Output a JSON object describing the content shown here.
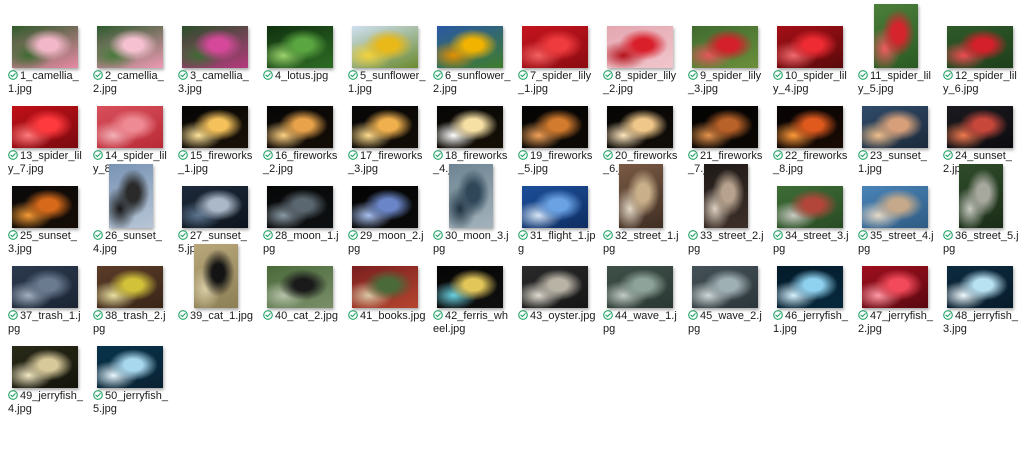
{
  "colors": {
    "sync_check": "#21a366",
    "background": "#ffffff",
    "caption_text": "#1a1a1a"
  },
  "status_icon": "cloud-synced-check-icon",
  "files": [
    {
      "name": "1_camellia_1.jpg",
      "orientation": "landscape",
      "thumb": [
        "#2f5a2a",
        "#f2b7c8",
        "#e88aa6",
        "#3d6b31"
      ]
    },
    {
      "name": "2_camellia_2.jpg",
      "orientation": "landscape",
      "thumb": [
        "#2c5a2c",
        "#f6c2d2",
        "#ef9ab5",
        "#477a3a"
      ]
    },
    {
      "name": "3_camellia_3.jpg",
      "orientation": "landscape",
      "thumb": [
        "#2b4f2a",
        "#d6499a",
        "#b53a7d",
        "#3f6b35"
      ]
    },
    {
      "name": "4_lotus.jpg",
      "orientation": "landscape",
      "thumb": [
        "#10310f",
        "#5aa640",
        "#2e6c25",
        "#9bd36c"
      ]
    },
    {
      "name": "5_sunflower_1.jpg",
      "orientation": "landscape",
      "thumb": [
        "#cfe0f0",
        "#e9b919",
        "#6a8a2f",
        "#f5d33a"
      ]
    },
    {
      "name": "6_sunflower_2.jpg",
      "orientation": "landscape",
      "thumb": [
        "#2a58a5",
        "#f2b300",
        "#3f7d2b",
        "#e28f00"
      ]
    },
    {
      "name": "7_spider_lily_1.jpg",
      "orientation": "landscape",
      "thumb": [
        "#c5141e",
        "#ee3b3e",
        "#8b0b12",
        "#f46262"
      ]
    },
    {
      "name": "8_spider_lily_2.jpg",
      "orientation": "landscape",
      "thumb": [
        "#e4a6b0",
        "#d81f2a",
        "#f0c6cc",
        "#b5121b"
      ]
    },
    {
      "name": "9_spider_lily_3.jpg",
      "orientation": "landscape",
      "thumb": [
        "#3f6b30",
        "#d4202a",
        "#6b8f3a",
        "#e4565a"
      ]
    },
    {
      "name": "10_spider_lily_4.jpg",
      "orientation": "landscape",
      "thumb": [
        "#a40f16",
        "#ee2b33",
        "#5a0a0c",
        "#f06a6d"
      ]
    },
    {
      "name": "11_spider_lily_5.jpg",
      "orientation": "portrait",
      "thumb": [
        "#4b7f3a",
        "#d6242d",
        "#2a5a23",
        "#f05a5f"
      ]
    },
    {
      "name": "12_spider_lily_6.jpg",
      "orientation": "landscape",
      "thumb": [
        "#2f5a2a",
        "#d4202a",
        "#1e3f1b",
        "#ee4c52"
      ]
    },
    {
      "name": "13_spider_lily_7.jpg",
      "orientation": "landscape",
      "thumb": [
        "#c11018",
        "#ff3a3e",
        "#7a0a0f",
        "#ff7a7c"
      ]
    },
    {
      "name": "14_spider_lily_8.jpg",
      "orientation": "landscape",
      "thumb": [
        "#d8505c",
        "#ee8a93",
        "#b82a36",
        "#f4b2b8"
      ]
    },
    {
      "name": "15_fireworks_1.jpg",
      "orientation": "landscape",
      "thumb": [
        "#050505",
        "#f4c15a",
        "#1a1208",
        "#ffe39a"
      ]
    },
    {
      "name": "16_fireworks_2.jpg",
      "orientation": "landscape",
      "thumb": [
        "#060606",
        "#e8a34a",
        "#140d06",
        "#ffd283"
      ]
    },
    {
      "name": "17_fireworks_3.jpg",
      "orientation": "landscape",
      "thumb": [
        "#070707",
        "#f0b04d",
        "#120c05",
        "#ffdc8e"
      ]
    },
    {
      "name": "18_fireworks_4.jpg",
      "orientation": "landscape",
      "thumb": [
        "#060606",
        "#f7e0a4",
        "#151006",
        "#ffffff"
      ]
    },
    {
      "name": "19_fireworks_5.jpg",
      "orientation": "landscape",
      "thumb": [
        "#040404",
        "#d27a2d",
        "#0d0905",
        "#f2a35a"
      ]
    },
    {
      "name": "20_fireworks_6.jpg",
      "orientation": "landscape",
      "thumb": [
        "#050505",
        "#f0c78a",
        "#120d07",
        "#ffe7bf"
      ]
    },
    {
      "name": "21_fireworks_7.jpg",
      "orientation": "landscape",
      "thumb": [
        "#030303",
        "#b86128",
        "#0b0704",
        "#e5934c"
      ]
    },
    {
      "name": "22_fireworks_8.jpg",
      "orientation": "landscape",
      "thumb": [
        "#050303",
        "#e05a1e",
        "#1a0b05",
        "#ff9a3a"
      ]
    },
    {
      "name": "23_sunset_1.jpg",
      "orientation": "landscape",
      "thumb": [
        "#2f4b6a",
        "#d8a07a",
        "#1c2a3b",
        "#f1c08c"
      ]
    },
    {
      "name": "24_sunset_2.jpg",
      "orientation": "landscape",
      "thumb": [
        "#1a1a1f",
        "#c7473b",
        "#0c0c10",
        "#f07a4f"
      ]
    },
    {
      "name": "25_sunset_3.jpg",
      "orientation": "landscape",
      "thumb": [
        "#0a0a0a",
        "#d66a1a",
        "#160c05",
        "#f49a35"
      ]
    },
    {
      "name": "26_sunset_4.jpg",
      "orientation": "portrait",
      "thumb": [
        "#7893b4",
        "#2a2a2a",
        "#b8c6d6",
        "#151515"
      ]
    },
    {
      "name": "27_sunset_5.jpg",
      "orientation": "landscape",
      "thumb": [
        "#1d2a3a",
        "#aab8c8",
        "#0d141e",
        "#5e7690"
      ]
    },
    {
      "name": "28_moon_1.jpg",
      "orientation": "landscape",
      "thumb": [
        "#060707",
        "#5b6770",
        "#0d1012",
        "#8a9aa4"
      ]
    },
    {
      "name": "29_moon_2.jpg",
      "orientation": "landscape",
      "thumb": [
        "#040404",
        "#6a86c8",
        "#0a0a0a",
        "#a8c0f0"
      ]
    },
    {
      "name": "30_moon_3.jpg",
      "orientation": "portrait",
      "thumb": [
        "#6e8492",
        "#2f4758",
        "#a4b3bc",
        "#1d3140"
      ]
    },
    {
      "name": "31_flight_1.jpg",
      "orientation": "landscape",
      "thumb": [
        "#1c4f9a",
        "#6aa2e4",
        "#0f2e62",
        "#d7e6f6"
      ]
    },
    {
      "name": "32_street_1.jpg",
      "orientation": "portrait",
      "thumb": [
        "#7a5a44",
        "#c9b08a",
        "#3f2e24",
        "#e3d7c5"
      ]
    },
    {
      "name": "33_street_2.jpg",
      "orientation": "portrait",
      "thumb": [
        "#1f1a18",
        "#b6a28e",
        "#3d2f28",
        "#e0d2c2"
      ]
    },
    {
      "name": "34_street_3.jpg",
      "orientation": "landscape",
      "thumb": [
        "#3d6d35",
        "#b3463a",
        "#2a4b25",
        "#c9c9c3"
      ]
    },
    {
      "name": "35_street_4.jpg",
      "orientation": "landscape",
      "thumb": [
        "#4a84b8",
        "#c6a98a",
        "#2e5b83",
        "#e7d9c6"
      ]
    },
    {
      "name": "36_street_5.jpg",
      "orientation": "portrait",
      "thumb": [
        "#2f4b2a",
        "#a6a79d",
        "#1a2d17",
        "#c9cac2"
      ]
    },
    {
      "name": "37_trash_1.jpg",
      "orientation": "landscape",
      "thumb": [
        "#2c3a4f",
        "#6a7a8f",
        "#1a2433",
        "#a2b0c2"
      ]
    },
    {
      "name": "38_trash_2.jpg",
      "orientation": "landscape",
      "thumb": [
        "#5b3b28",
        "#d2c23a",
        "#3a2618",
        "#e8e0a0"
      ]
    },
    {
      "name": "39_cat_1.jpg",
      "orientation": "portrait",
      "thumb": [
        "#b8a77a",
        "#141414",
        "#8c7f55",
        "#d8cca6"
      ]
    },
    {
      "name": "40_cat_2.jpg",
      "orientation": "landscape",
      "thumb": [
        "#4a6a3a",
        "#1a1a1a",
        "#7a8f6a",
        "#b6c2a8"
      ]
    },
    {
      "name": "41_books.jpg",
      "orientation": "landscape",
      "thumb": [
        "#7a1f1f",
        "#4a6a3a",
        "#b5452f",
        "#d9c6a3"
      ]
    },
    {
      "name": "42_ferris_wheel.jpg",
      "orientation": "landscape",
      "thumb": [
        "#050505",
        "#e2c65a",
        "#0f0f0f",
        "#6ad0e0"
      ]
    },
    {
      "name": "43_oyster.jpg",
      "orientation": "landscape",
      "thumb": [
        "#2a2a2a",
        "#b9b3a6",
        "#151515",
        "#e3ded3"
      ]
    },
    {
      "name": "44_wave_1.jpg",
      "orientation": "landscape",
      "thumb": [
        "#3f5049",
        "#8ea49a",
        "#2b3833",
        "#c2ccc5"
      ]
    },
    {
      "name": "45_wave_2.jpg",
      "orientation": "landscape",
      "thumb": [
        "#445157",
        "#9fb0b4",
        "#2c363a",
        "#d0d8d9"
      ]
    },
    {
      "name": "46_jerryfish_1.jpg",
      "orientation": "landscape",
      "thumb": [
        "#041b2a",
        "#8fd2f0",
        "#06283c",
        "#d8f2ff"
      ]
    },
    {
      "name": "47_jerryfish_2.jpg",
      "orientation": "landscape",
      "thumb": [
        "#9e0f1e",
        "#f24a5a",
        "#5a0810",
        "#ff9aa6"
      ]
    },
    {
      "name": "48_jerryfish_3.jpg",
      "orientation": "landscape",
      "thumb": [
        "#0c2a3f",
        "#b8e2f2",
        "#081c2b",
        "#f0fbff"
      ]
    },
    {
      "name": "49_jerryfish_4.jpg",
      "orientation": "landscape",
      "thumb": [
        "#2a2a18",
        "#d8c99a",
        "#14140b",
        "#f3e9c4"
      ]
    },
    {
      "name": "50_jerryfish_5.jpg",
      "orientation": "landscape",
      "thumb": [
        "#07334a",
        "#a8d8ee",
        "#0a2233",
        "#e8f7ff"
      ]
    }
  ]
}
